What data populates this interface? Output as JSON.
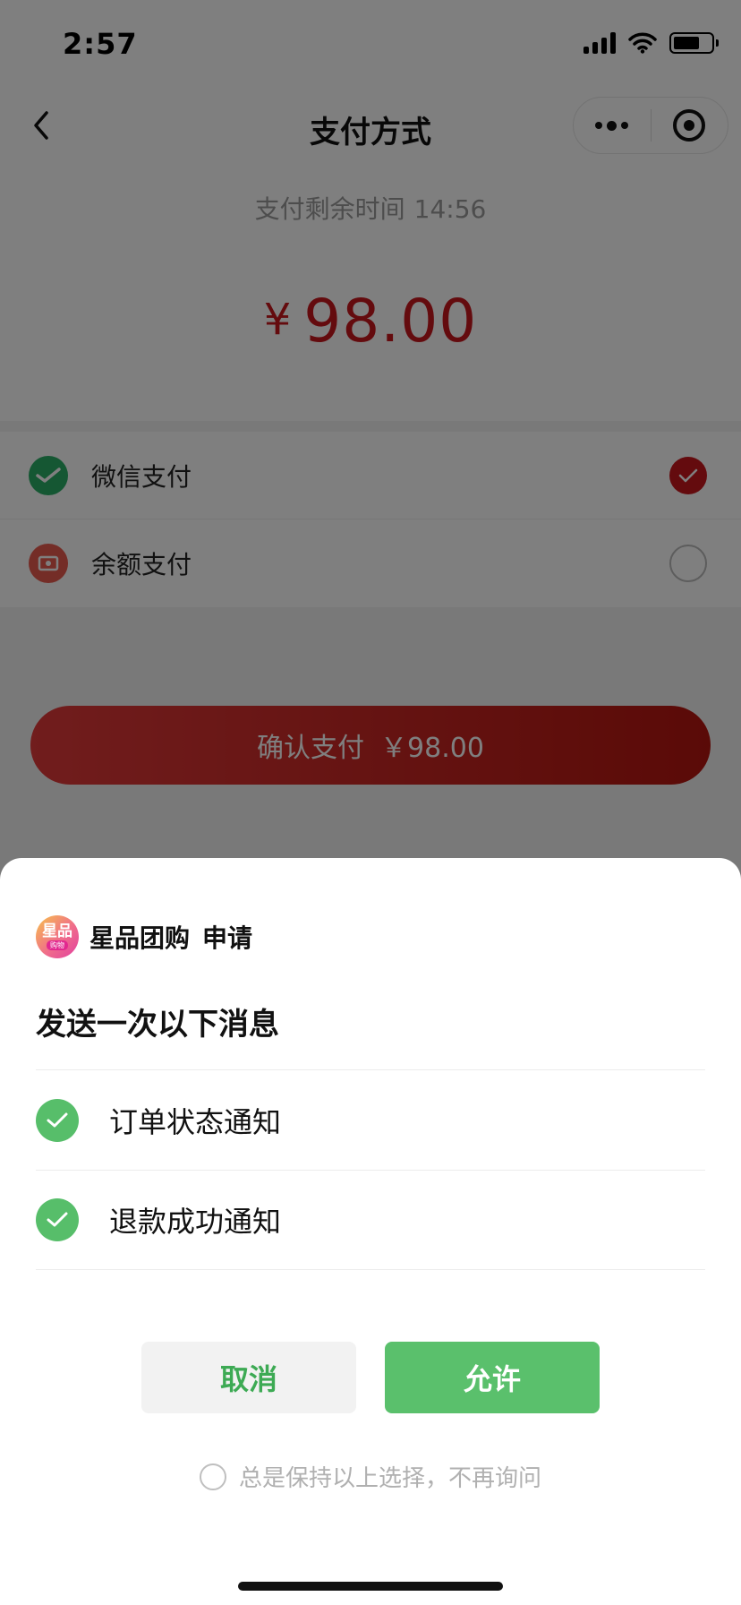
{
  "status_bar": {
    "time": "2:57",
    "icons": [
      "signal-icon",
      "wifi-icon",
      "battery-icon"
    ]
  },
  "nav": {
    "back_icon": "chevron-left-icon",
    "title": "支付方式",
    "more_icon": "more-dots-icon",
    "close_icon": "target-circle-icon"
  },
  "payment": {
    "countdown_label": "支付剩余时间",
    "countdown_time": "14:56",
    "currency_symbol": "¥",
    "amount": "98.00",
    "accent_color": "#c8161d"
  },
  "methods": [
    {
      "icon": "wechat-pay-icon",
      "label": "微信支付",
      "selected": true
    },
    {
      "icon": "balance-wallet-icon",
      "label": "余额支付",
      "selected": false
    }
  ],
  "confirm": {
    "label": "确认支付",
    "amount": "￥98.00"
  },
  "sheet": {
    "app_name": "星品团购",
    "app_logo_text": "星品",
    "app_logo_sub": "购物",
    "request_word": "申请",
    "title": "发送一次以下消息",
    "messages": [
      {
        "label": "订单状态通知",
        "checked": true
      },
      {
        "label": "退款成功通知",
        "checked": true
      }
    ],
    "cancel_label": "取消",
    "allow_label": "允许",
    "keep_choice_label": "总是保持以上选择，不再询问",
    "brand_green": "#5ac06c"
  }
}
